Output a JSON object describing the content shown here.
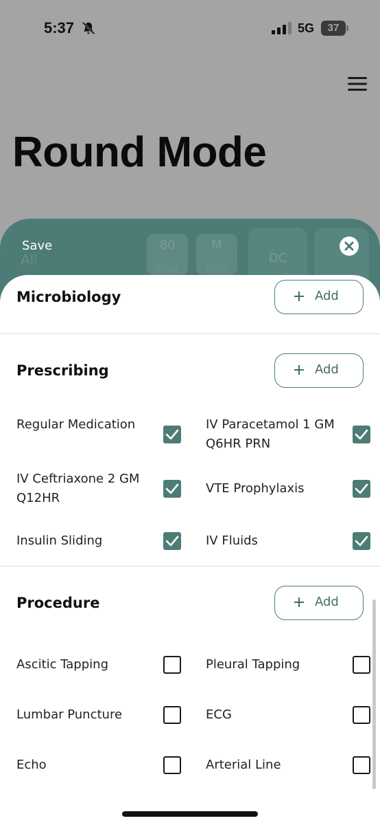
{
  "status_bar": {
    "time": "5:37",
    "network": "5G",
    "battery": "37"
  },
  "page": {
    "title": "Round Mode"
  },
  "patient": {
    "name": "Ali",
    "age_value": "80",
    "age_label": "Age",
    "sex_value": "M",
    "sex_label": "Sex",
    "dc_label": "DC",
    "plus_label": "+"
  },
  "sheet": {
    "save_label": "Save"
  },
  "sections": {
    "microbiology": {
      "title": "Microbiology",
      "add_label": "Add"
    },
    "prescribing": {
      "title": "Prescribing",
      "add_label": "Add",
      "items": [
        {
          "label": "Regular Medication",
          "checked": true
        },
        {
          "label": "IV Paracetamol 1 GM Q6HR PRN",
          "checked": true
        },
        {
          "label": "IV Ceftriaxone 2 GM Q12HR",
          "checked": true
        },
        {
          "label": "VTE Prophylaxis",
          "checked": true
        },
        {
          "label": "Insulin Sliding",
          "checked": true
        },
        {
          "label": "IV Fluids",
          "checked": true
        }
      ]
    },
    "procedure": {
      "title": "Procedure",
      "add_label": "Add",
      "items": [
        {
          "label": "Ascitic Tapping",
          "checked": false
        },
        {
          "label": "Pleural Tapping",
          "checked": false
        },
        {
          "label": "Lumbar Puncture",
          "checked": false
        },
        {
          "label": "ECG",
          "checked": false
        },
        {
          "label": "Echo",
          "checked": false
        },
        {
          "label": "Arterial Line",
          "checked": false
        }
      ]
    }
  },
  "icons": {
    "bell": "bell-slash-icon",
    "signal": "cellular-signal-icon",
    "menu": "hamburger-menu-icon",
    "close": "close-circle-icon",
    "add": "plus-icon",
    "check": "checkmark-icon"
  },
  "colors": {
    "accent": "#4d7c76",
    "overlay": "#a4a4a4",
    "sheet": "#ffffff"
  }
}
